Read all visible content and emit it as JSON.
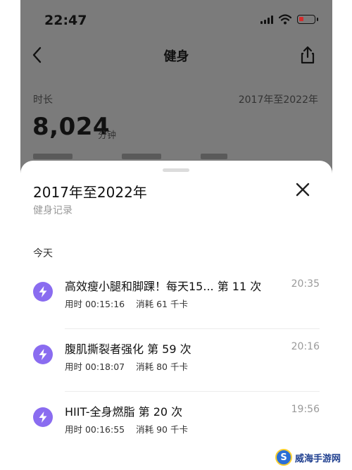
{
  "status_bar": {
    "time": "22:47"
  },
  "nav": {
    "title": "健身"
  },
  "summary": {
    "label": "时长",
    "range": "2017年至2022年",
    "value": "8,024",
    "unit": "分钟"
  },
  "sheet": {
    "title": "2017年至2022年",
    "subtitle": "健身记录",
    "section": "今天",
    "records": [
      {
        "title": "高效瘦小腿和脚踝！每天15...  第 11 次",
        "duration": "用时 00:15:16",
        "calories": "消耗 61 千卡",
        "time": "20:35"
      },
      {
        "title": "腹肌撕裂者强化 第 59 次",
        "duration": "用时 00:18:07",
        "calories": "消耗 80 千卡",
        "time": "20:16"
      },
      {
        "title": "HIIT-全身燃脂 第 20 次",
        "duration": "用时 00:16:55",
        "calories": "消耗 90 千卡",
        "time": "19:56"
      }
    ]
  },
  "watermark": {
    "text": "威海手游网"
  },
  "colors": {
    "accent": "#8a6cf0",
    "dim_overlay": "#7b7b7b",
    "battery_low": "#d62c2c"
  },
  "icons": {
    "back": "chevron-left-icon",
    "share": "share-icon",
    "close": "close-icon",
    "record": "lightning-icon"
  }
}
